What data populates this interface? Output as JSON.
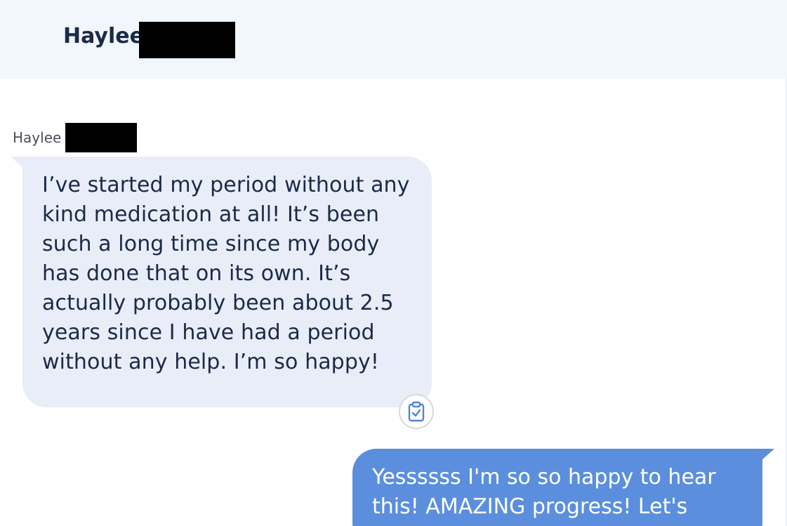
{
  "header": {
    "contact_name": "Haylee"
  },
  "thread": {
    "incoming": {
      "sender_label": "Haylee",
      "text": "I’ve started my period without any kind medication at all! It’s been such a long time since my body has done that on its own. It’s actually probably been about 2.5 years since I have had a period without any help. I’m so happy!",
      "action_icon": "clipboard-check-icon"
    },
    "outgoing": {
      "text": "Yessssss I'm so so happy to hear this! AMAZING progress! Let's"
    }
  },
  "colors": {
    "header_bg": "#f2f6fd",
    "incoming_bubble": "#e8edf8",
    "outgoing_bubble": "#5b8fdd",
    "text_dark": "#1b2a47",
    "icon_blue": "#4f86d6"
  }
}
